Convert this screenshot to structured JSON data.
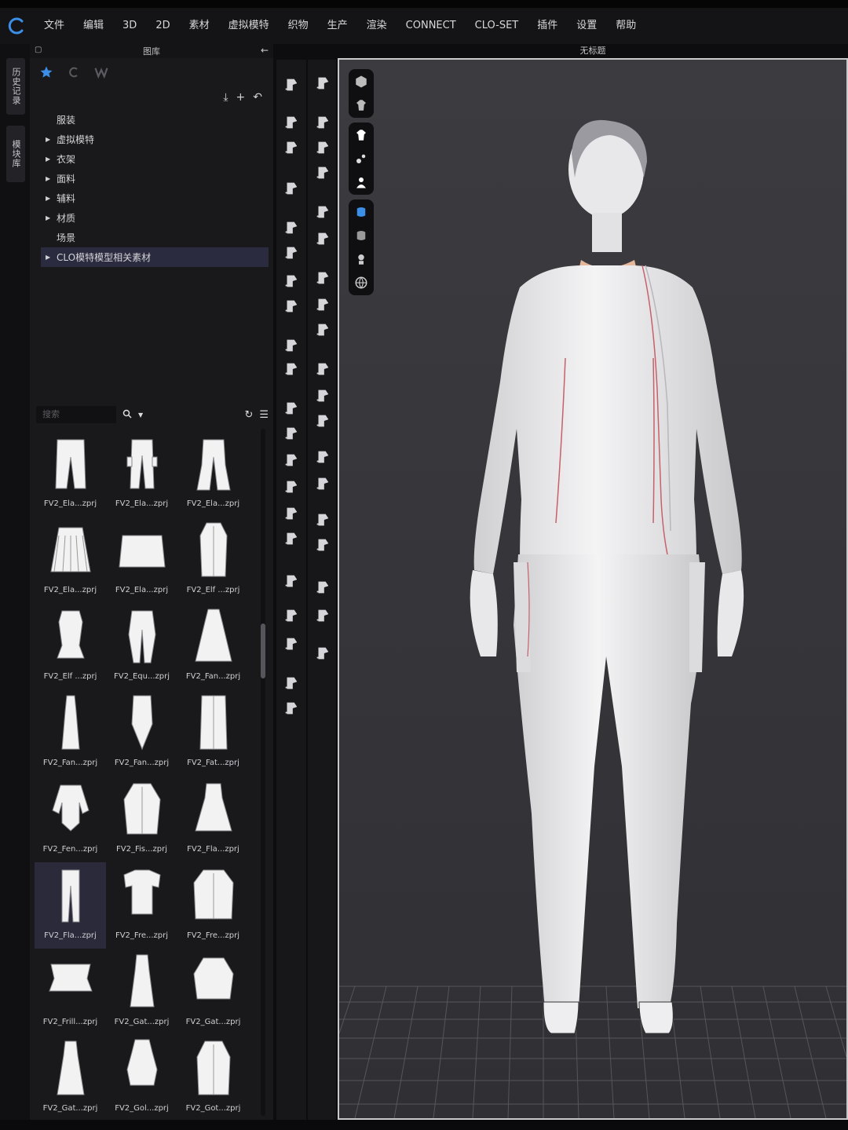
{
  "menubar": {
    "items": [
      "文件",
      "编辑",
      "3D",
      "2D",
      "素材",
      "虚拟模特",
      "织物",
      "生产",
      "渲染",
      "CONNECT",
      "CLO-SET",
      "插件",
      "设置",
      "帮助"
    ]
  },
  "sidetabs": [
    "历史记录",
    "模块库"
  ],
  "library": {
    "title": "图库",
    "tree": [
      {
        "label": "服装",
        "expandable": false,
        "selected": false
      },
      {
        "label": "虚拟模特",
        "expandable": true,
        "selected": false
      },
      {
        "label": "衣架",
        "expandable": true,
        "selected": false
      },
      {
        "label": "面料",
        "expandable": true,
        "selected": false
      },
      {
        "label": "辅料",
        "expandable": true,
        "selected": false
      },
      {
        "label": "材质",
        "expandable": true,
        "selected": false
      },
      {
        "label": "场景",
        "expandable": false,
        "selected": false
      },
      {
        "label": "CLO模特模型相关素材",
        "expandable": true,
        "selected": true
      }
    ],
    "search_placeholder": "搜索",
    "files": [
      {
        "name": "FV2_Ela...zprj",
        "icon": "pants-icon"
      },
      {
        "name": "FV2_Ela...zprj",
        "icon": "cargo-pants-icon"
      },
      {
        "name": "FV2_Ela...zprj",
        "icon": "flare-pants-icon"
      },
      {
        "name": "FV2_Ela...zprj",
        "icon": "pleated-skirt-icon"
      },
      {
        "name": "FV2_Ela...zprj",
        "icon": "mini-skirt-icon"
      },
      {
        "name": "FV2_Elf ...zprj",
        "icon": "long-coat-icon"
      },
      {
        "name": "FV2_Elf ...zprj",
        "icon": "vest-top-icon"
      },
      {
        "name": "FV2_Equ...zprj",
        "icon": "riding-pants-icon"
      },
      {
        "name": "FV2_Fan...zprj",
        "icon": "cape-dress-icon"
      },
      {
        "name": "FV2_Fan...zprj",
        "icon": "gown-icon"
      },
      {
        "name": "FV2_Fan...zprj",
        "icon": "tabard-icon"
      },
      {
        "name": "FV2_Fat...zprj",
        "icon": "apron-skirt-icon"
      },
      {
        "name": "FV2_Fen...zprj",
        "icon": "bodysuit-icon"
      },
      {
        "name": "FV2_Fis...zprj",
        "icon": "jacket-icon"
      },
      {
        "name": "FV2_Fla...zprj",
        "icon": "dress-icon"
      },
      {
        "name": "FV2_Fla...zprj",
        "icon": "slim-pants-icon"
      },
      {
        "name": "FV2_Fre...zprj",
        "icon": "tshirt-icon"
      },
      {
        "name": "FV2_Fre...zprj",
        "icon": "blazer-icon"
      },
      {
        "name": "FV2_Frill...zprj",
        "icon": "frill-top-icon"
      },
      {
        "name": "FV2_Gat...zprj",
        "icon": "slip-dress-icon"
      },
      {
        "name": "FV2_Gat...zprj",
        "icon": "smock-icon"
      },
      {
        "name": "FV2_Gat...zprj",
        "icon": "maxi-dress-icon"
      },
      {
        "name": "FV2_Gol...zprj",
        "icon": "hoodie-icon"
      },
      {
        "name": "FV2_Got...zprj",
        "icon": "gothic-coat-icon"
      }
    ],
    "selected_file_index": 15
  },
  "viewport": {
    "title": "无标题"
  },
  "colors": {
    "accent_blue": "#3b8fe6",
    "selected_row": "#2b2b3f",
    "viewport_bg": "#3a3a3e"
  }
}
